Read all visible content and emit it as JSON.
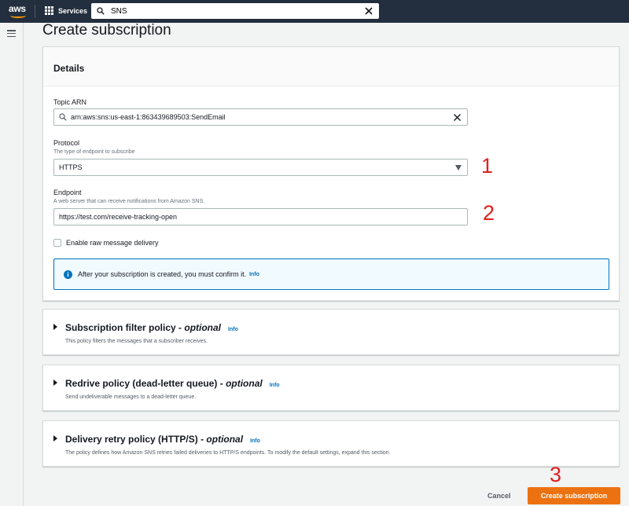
{
  "nav": {
    "logo_text": "aws",
    "services_label": "Services",
    "search_value": "SNS"
  },
  "page": {
    "title": "Create subscription"
  },
  "details": {
    "header": "Details",
    "topic_arn_label": "Topic ARN",
    "topic_arn_value": "arn:aws:sns:us-east-1:863439689503:SendEmail",
    "protocol_label": "Protocol",
    "protocol_desc": "The type of endpoint to subscribe",
    "protocol_value": "HTTPS",
    "endpoint_label": "Endpoint",
    "endpoint_desc": "A web server that can receive notifications from Amazon SNS.",
    "endpoint_value": "https://test.com/receive-tracking-open",
    "raw_delivery_label": "Enable raw message delivery",
    "raw_delivery_checked": false,
    "alert_text": "After your subscription is created, you must confirm it.",
    "alert_info": "Info"
  },
  "sections": [
    {
      "title": "Subscription filter policy",
      "optional": "optional",
      "info": "Info",
      "desc": "This policy filters the messages that a subscriber receives."
    },
    {
      "title": "Redrive policy (dead-letter queue)",
      "optional": "optional",
      "info": "Info",
      "desc": "Send undeliverable messages to a dead-letter queue."
    },
    {
      "title": "Delivery retry policy (HTTP/S)",
      "optional": "optional",
      "info": "Info",
      "desc": "The policy defines how Amazon SNS retries failed deliveries to HTTP/S endpoints. To modify the default settings, expand this section."
    }
  ],
  "footer": {
    "cancel_label": "Cancel",
    "create_label": "Create subscription"
  },
  "annotations": {
    "step1": "1",
    "step2": "2",
    "step3": "3"
  },
  "colors": {
    "nav_bg": "#232f3e",
    "primary_button": "#ec7211",
    "link": "#0073bb",
    "annotation": "#e02020"
  }
}
